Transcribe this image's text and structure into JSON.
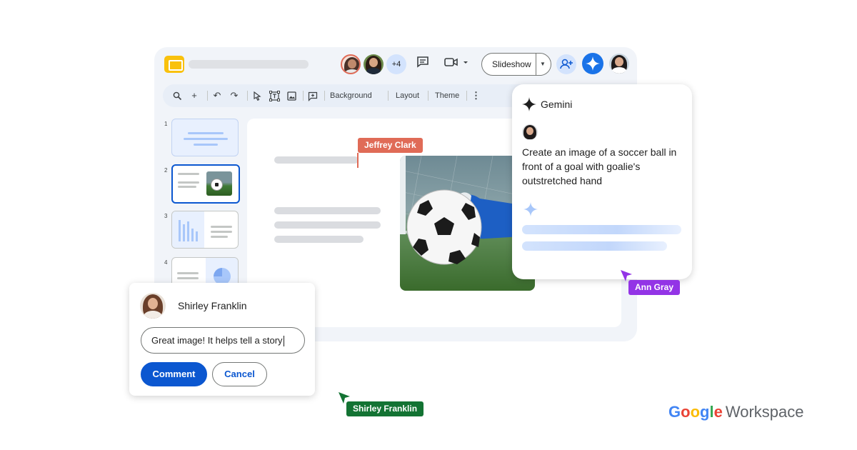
{
  "toolbar": {
    "slideshow_label": "Slideshow",
    "collaborator_overflow": "+4",
    "background_label": "Background",
    "layout_label": "Layout",
    "theme_label": "Theme"
  },
  "filmstrip": {
    "slide_numbers": [
      "1",
      "2",
      "3",
      "4"
    ]
  },
  "cursors": {
    "jeffrey": "Jeffrey Clark",
    "ann": "Ann Gray",
    "shirley": "Shirley Franklin"
  },
  "gemini": {
    "title": "Gemini",
    "prompt": "Create an image of a soccer ball in front of a goal with goalie's outstretched hand"
  },
  "comment": {
    "author": "Shirley Franklin",
    "input_value": "Great image! It helps tell a story",
    "submit_label": "Comment",
    "cancel_label": "Cancel"
  },
  "brand": {
    "google_letters": [
      "G",
      "o",
      "o",
      "g",
      "l",
      "e"
    ],
    "product": "Workspace"
  },
  "colors": {
    "accent_blue": "#0b57d0",
    "jeffrey_tag": "#e06b57",
    "ann_tag": "#9334e6",
    "shirley_tag": "#137333",
    "slides_yellow": "#f9c10d"
  }
}
